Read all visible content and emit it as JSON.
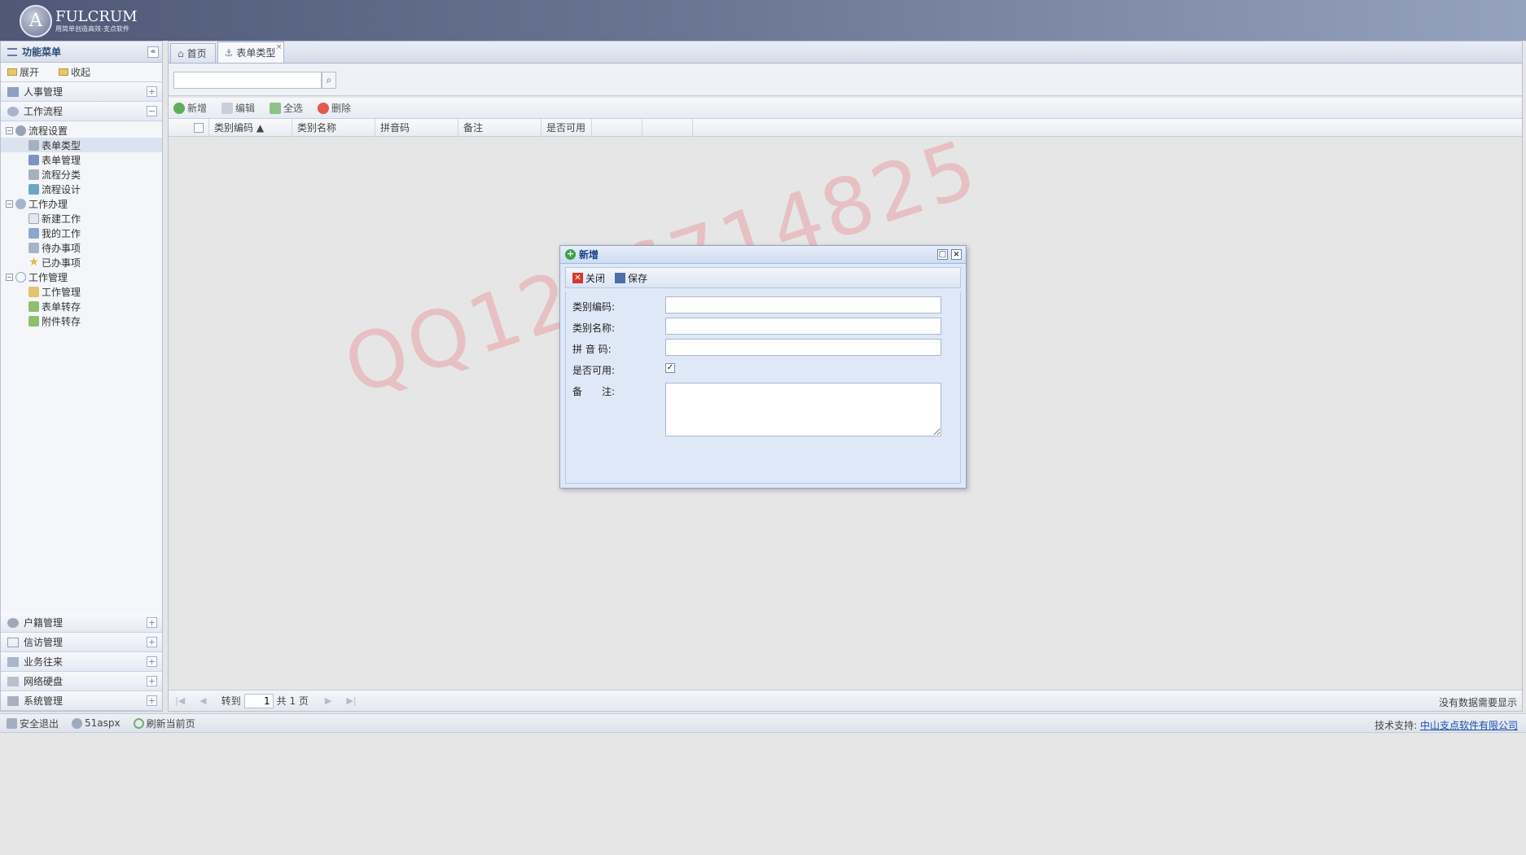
{
  "header": {
    "logo_letter": "A",
    "logo_title": "FULCRUM",
    "logo_sub": "用简单创造高效-支点软件"
  },
  "sidebar": {
    "title": "功能菜单",
    "collapse_icon": "«",
    "expand_label": "展开",
    "collapse_label": "收起",
    "groups_top": [
      {
        "label": "人事管理",
        "pm": "+"
      },
      {
        "label": "工作流程",
        "pm": "−"
      }
    ],
    "tree": [
      {
        "label": "流程设置",
        "level": 1,
        "toggle": "−"
      },
      {
        "label": "表单类型",
        "level": 2,
        "selected": true
      },
      {
        "label": "表单管理",
        "level": 2
      },
      {
        "label": "流程分类",
        "level": 2
      },
      {
        "label": "流程设计",
        "level": 2
      },
      {
        "label": "工作办理",
        "level": 1,
        "toggle": "−"
      },
      {
        "label": "新建工作",
        "level": 2
      },
      {
        "label": "我的工作",
        "level": 2
      },
      {
        "label": "待办事项",
        "level": 2
      },
      {
        "label": "已办事项",
        "level": 2
      },
      {
        "label": "工作管理",
        "level": 1,
        "toggle": "−"
      },
      {
        "label": "工作管理",
        "level": 2
      },
      {
        "label": "表单转存",
        "level": 2
      },
      {
        "label": "附件转存",
        "level": 2
      }
    ],
    "groups_bottom": [
      {
        "label": "户籍管理",
        "pm": "+"
      },
      {
        "label": "信访管理",
        "pm": "+"
      },
      {
        "label": "业务往来",
        "pm": "+"
      },
      {
        "label": "网络硬盘",
        "pm": "+"
      },
      {
        "label": "系统管理",
        "pm": "+"
      }
    ]
  },
  "tabs": [
    {
      "label": "首页",
      "icon": "home-icon"
    },
    {
      "label": "表单类型",
      "icon": "anchor-icon",
      "active": true,
      "close": "×"
    }
  ],
  "search": {
    "button": "⌕"
  },
  "toolbar": {
    "add": "新增",
    "edit": "编辑",
    "select_all": "全选",
    "delete": "删除"
  },
  "grid": {
    "columns": [
      "类别编码 ▲",
      "类别名称",
      "拼音码",
      "备注",
      "是否可用"
    ]
  },
  "pager": {
    "first": "|◀",
    "prev": "◀",
    "goto": "转到",
    "page": "1",
    "total": "共 1 页",
    "next": "▶",
    "last": "▶|",
    "info": "没有数据需要显示"
  },
  "footer": {
    "logout": "安全退出",
    "user": "51aspx",
    "refresh": "刷新当前页",
    "support_label": "技术支持:",
    "company": "中山支点软件有限公司"
  },
  "watermark": "QQ1216714825",
  "dialog": {
    "title": "新增",
    "maximize": "□",
    "close_x": "×",
    "close_btn": "关闭",
    "save_btn": "保存",
    "fields": {
      "code_label": "类别编码:",
      "name_label": "类别名称:",
      "pinyin_label": "拼 音 码:",
      "enabled_label": "是否可用:",
      "enabled_mark": "✓",
      "remark_label": "备　　注:"
    }
  },
  "colors": {
    "header_start": "#4f5877",
    "header_end": "#95a2bd",
    "dialog_title": "#15428b",
    "link": "#1a4fae",
    "watermark": "#e47880"
  }
}
